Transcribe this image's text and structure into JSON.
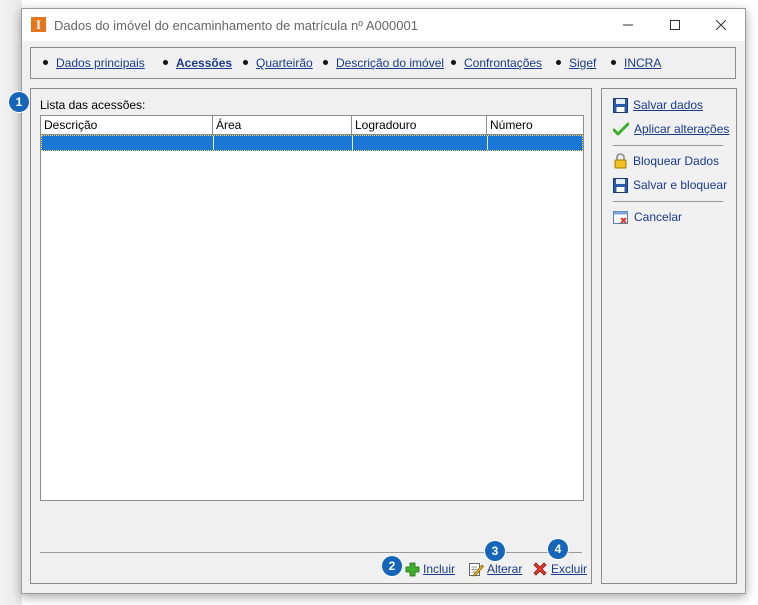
{
  "window": {
    "title": "Dados do imóvel do encaminhamento de matrícula nº A000001",
    "app_icon_letter": "I"
  },
  "tabs": [
    {
      "label": "Dados principais",
      "active": false
    },
    {
      "label": "Acessões",
      "active": true
    },
    {
      "label": "Quarteirão",
      "active": false
    },
    {
      "label": "Descrição do imóvel",
      "active": false
    },
    {
      "label": "Confrontações",
      "active": false
    },
    {
      "label": "Sigef",
      "active": false
    },
    {
      "label": "INCRA",
      "active": false
    }
  ],
  "main": {
    "list_label": "Lista das acessões:",
    "columns": [
      "Descrição",
      "Área",
      "Logradouro",
      "Número"
    ],
    "rows": [
      {
        "descricao": "",
        "area": "",
        "logradouro": "",
        "numero": "",
        "selected": true
      }
    ]
  },
  "actions": {
    "incluir": "Incluir",
    "alterar": "Alterar",
    "excluir": "Excluir"
  },
  "sidebar": {
    "salvar_dados": "Salvar dados",
    "aplicar_alteracoes": "Aplicar alterações",
    "bloquear_dados": "Bloquear Dados",
    "salvar_bloquear": "Salvar e bloquear",
    "cancelar": "Cancelar"
  },
  "badges": [
    "1",
    "2",
    "3",
    "4"
  ],
  "colors": {
    "accent": "#1565b8",
    "selection": "#1a78d4",
    "link": "#1a3a8a",
    "app_icon": "#e6761e"
  }
}
